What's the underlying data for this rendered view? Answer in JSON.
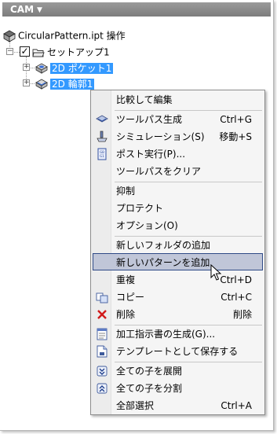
{
  "panel": {
    "title": "CAM"
  },
  "tree": {
    "document": "CircularPattern.ipt 操作",
    "setup": "セットアップ1",
    "op1": "2D ポケット1",
    "op2": "2D 輪郭1"
  },
  "menu": {
    "compare_edit": "比較して編集",
    "generate_toolpath": "ツールパス生成",
    "generate_toolpath_sc": "Ctrl+G",
    "simulation": "シミュレーション(S)",
    "simulation_sc": "移動+S",
    "post_process": "ポスト実行(P)...",
    "clear_toolpath": "ツールパスをクリア",
    "suppress": "抑制",
    "protect": "プロテクト",
    "options": "オプション(O)",
    "new_folder": "新しいフォルダの追加",
    "new_pattern": "新しいパターンを追加",
    "duplicate": "重複",
    "duplicate_sc": "Ctrl+D",
    "copy": "コピー",
    "copy_sc": "Ctrl+C",
    "delete": "削除",
    "delete_sc": "削除",
    "setup_sheet": "加工指示書の生成(G)...",
    "save_template": "テンプレートとして保存する",
    "expand_all": "全ての子を展開",
    "collapse_all": "全ての子を分割",
    "select_all": "全部選択",
    "select_all_sc": "Ctrl+A"
  }
}
